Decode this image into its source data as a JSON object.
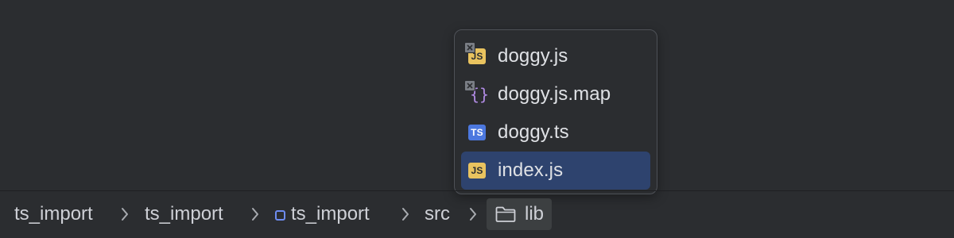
{
  "popup": {
    "items": [
      {
        "label": "doggy.js",
        "icon": "js-file-icon",
        "excluded": true,
        "selected": false
      },
      {
        "label": "doggy.js.map",
        "icon": "json-map-file-icon",
        "excluded": true,
        "selected": false
      },
      {
        "label": "doggy.ts",
        "icon": "ts-file-icon",
        "excluded": false,
        "selected": false
      },
      {
        "label": "index.js",
        "icon": "js-file-icon",
        "excluded": false,
        "selected": true
      }
    ],
    "icon_text": {
      "js": "JS",
      "ts": "TS",
      "map": "{}"
    }
  },
  "breadcrumbs": [
    {
      "label": "ts_import",
      "icon": null
    },
    {
      "label": "ts_import",
      "icon": null
    },
    {
      "label": "ts_import",
      "icon": "module-icon"
    },
    {
      "label": "src",
      "icon": null
    },
    {
      "label": "lib",
      "icon": "folder-icon",
      "active": true
    }
  ],
  "colors": {
    "background": "#2b2d30",
    "selection": "#2e436e",
    "js_badge": "#e9c35f",
    "ts_badge": "#4c78df",
    "module_accent": "#6e8cf0"
  }
}
